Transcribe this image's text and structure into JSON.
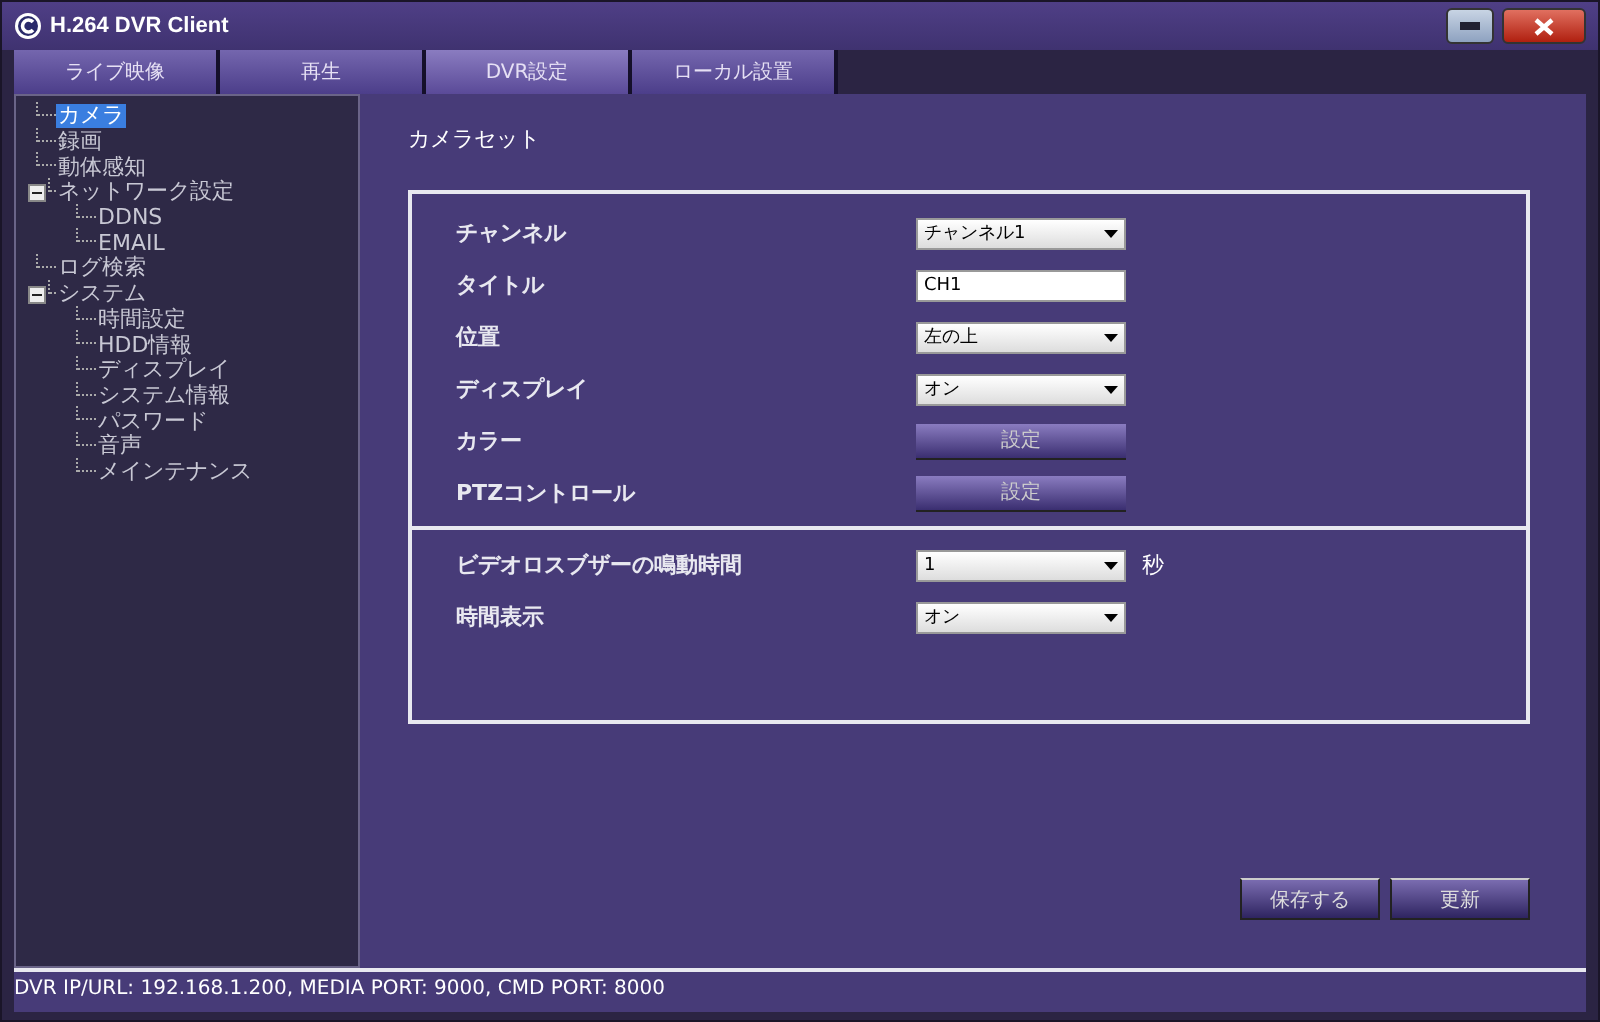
{
  "window": {
    "title": "H.264 DVR Client"
  },
  "tabs": [
    {
      "label": "ライブ映像",
      "selected": false
    },
    {
      "label": "再生",
      "selected": false
    },
    {
      "label": "DVR設定",
      "selected": true
    },
    {
      "label": "ローカル設置",
      "selected": false
    }
  ],
  "tree": [
    {
      "label": "カメラ",
      "selected": true
    },
    {
      "label": "録画",
      "selected": false
    },
    {
      "label": "動体感知",
      "selected": false
    },
    {
      "label": "ネットワーク設定",
      "selected": false,
      "expanded": true,
      "children": [
        {
          "label": "DDNS",
          "selected": false
        },
        {
          "label": "EMAIL",
          "selected": false
        }
      ]
    },
    {
      "label": "ログ検索",
      "selected": false
    },
    {
      "label": "システム",
      "selected": false,
      "expanded": true,
      "children": [
        {
          "label": "時間設定",
          "selected": false
        },
        {
          "label": "HDD情報",
          "selected": false
        },
        {
          "label": "ディスプレイ",
          "selected": false
        },
        {
          "label": "システム情報",
          "selected": false
        },
        {
          "label": "パスワード",
          "selected": false
        },
        {
          "label": "音声",
          "selected": false
        },
        {
          "label": "メインテナンス",
          "selected": false
        }
      ]
    }
  ],
  "page_title": "カメラセット",
  "sections": [
    {
      "rows": [
        {
          "label": "チャンネル",
          "kind": "select",
          "value": "チャンネル1"
        },
        {
          "label": "タイトル",
          "kind": "text",
          "value": "CH1"
        },
        {
          "label": "位置",
          "kind": "select",
          "value": "左の上"
        },
        {
          "label": "ディスプレイ",
          "kind": "select",
          "value": "オン"
        },
        {
          "label": "カラー",
          "kind": "button",
          "value": "設定"
        },
        {
          "label": "PTZコントロール",
          "kind": "button",
          "value": "設定"
        }
      ]
    },
    {
      "rows": [
        {
          "label": "ビデオロスブザーの鳴動時間",
          "kind": "select",
          "value": "1",
          "unit": "秒"
        },
        {
          "label": "時間表示",
          "kind": "select",
          "value": "オン"
        }
      ]
    }
  ],
  "buttons": [
    "保存する",
    "更新"
  ],
  "status_bar": "DVR IP/URL: 192.168.1.200, MEDIA PORT: 9000, CMD PORT: 8000"
}
